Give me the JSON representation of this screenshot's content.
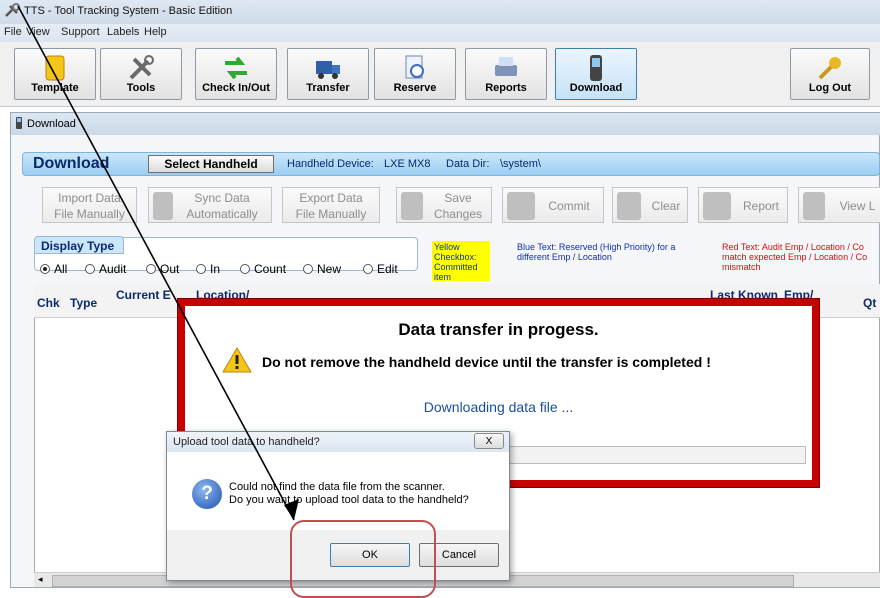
{
  "window": {
    "title": "TTS - Tool Tracking System - Basic Edition"
  },
  "menu": [
    "File",
    "View",
    "Support",
    "Labels",
    "Help"
  ],
  "toolbar": {
    "buttons": [
      "Template",
      "Tools",
      "Check In/Out",
      "Transfer",
      "Reserve",
      "Reports",
      "Download"
    ],
    "logout": "Log Out"
  },
  "child": {
    "title": "Download"
  },
  "download_header": {
    "title": "Download",
    "select_handheld": "Select Handheld",
    "device_label": "Handheld Device:",
    "device_value": "LXE MX8",
    "datadir_label": "Data Dir:",
    "datadir_value": "\\system\\"
  },
  "actions": {
    "import": [
      "Import Data",
      "File Manually"
    ],
    "sync": [
      "Sync Data",
      "Automatically"
    ],
    "export": [
      "Export Data",
      "File Manually"
    ],
    "save": [
      "Save",
      "Changes"
    ],
    "commit": "Commit",
    "clear": "Clear",
    "report": "Report",
    "view": "View L"
  },
  "display_type": {
    "label": "Display Type",
    "options": [
      "All",
      "Audit",
      "Out",
      "In",
      "Count",
      "New",
      "Edit"
    ],
    "selected": "All"
  },
  "legend": {
    "yellow": "Yellow Checkbox: Committed item",
    "blue": "Blue Text: Reserved (High Priority) for a different Emp / Location",
    "red": "Red Text: Audit Emp / Location / Co match expected Emp / Location / Co mismatch"
  },
  "grid": {
    "headers": [
      "Chk",
      "Type",
      "Current E",
      "Location/",
      "Last Known",
      "Emp/",
      "Qt"
    ]
  },
  "progress_dialog": {
    "title": "Data transfer in progess.",
    "message": "Do not remove the handheld device until the transfer is completed !",
    "status": "Downloading data file ..."
  },
  "upload_dialog": {
    "title": "Upload tool data to handheld?",
    "close": "X",
    "line1": "Could not find the data file from the scanner.",
    "line2": "Do you want to upload tool data to the handheld?",
    "ok": "OK",
    "cancel": "Cancel"
  },
  "colors": {
    "progress_border": "#c80000",
    "highlight": "#c0504d",
    "header_blue": "#0a2a6c"
  }
}
